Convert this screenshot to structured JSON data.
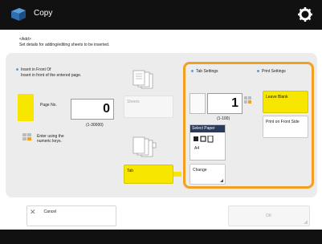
{
  "header": {
    "title": "Copy",
    "app_icon": "copy-app-icon",
    "settings_icon": "gear-icon"
  },
  "subtitle": {
    "line1": "<Add>",
    "line2": "Set details for adding/editing sheets to be inserted."
  },
  "insert": {
    "label": "Insert in Front Of",
    "desc": "Insert in front of the entered page.",
    "page_label": "Page No.",
    "page_value": "0",
    "range": "(1-30000)",
    "keys_hint": "Enter using the numeric keys."
  },
  "sheets_button": "Sheets",
  "tab_button": "Tab",
  "tab_settings": {
    "label": "Tab Settings",
    "value": "1",
    "range": "(1-100)",
    "select_paper_header": "Select Paper",
    "paper_size": "A4",
    "change_label": "Change"
  },
  "print_settings": {
    "label": "Print Settings",
    "leave_blank": "Leave Blank",
    "print_front": "Print on Front Side"
  },
  "footer": {
    "cancel": "Cancel",
    "ok": "OK"
  },
  "colors": {
    "accent_yellow": "#f7e600",
    "highlight_orange": "#f3a020",
    "title_bar": "#111111"
  }
}
